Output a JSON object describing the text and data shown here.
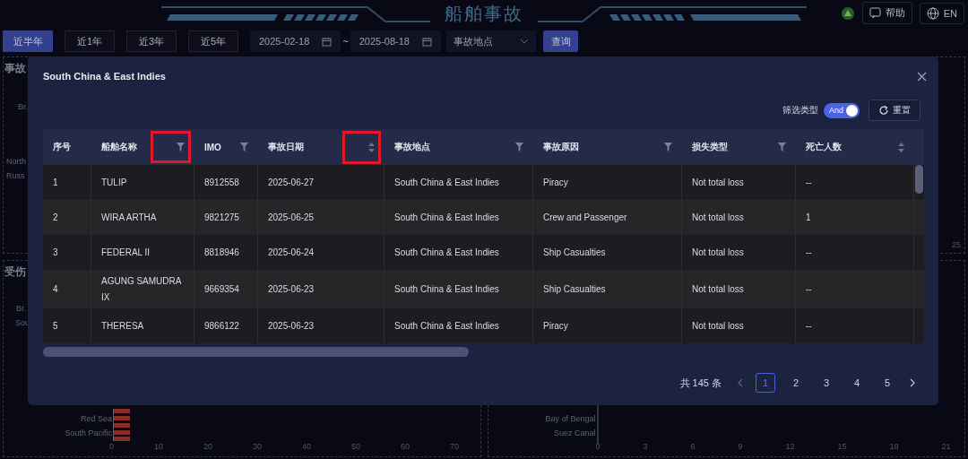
{
  "header": {
    "title": "船舶事故",
    "help": "帮助",
    "language": "EN"
  },
  "filters": {
    "ranges": [
      {
        "label": "近半年",
        "selected": true
      },
      {
        "label": "近1年",
        "selected": false
      },
      {
        "label": "近3年",
        "selected": false
      },
      {
        "label": "近5年",
        "selected": false
      }
    ],
    "start_date": "2025-02-18",
    "separator": "~",
    "end_date": "2025-08-18",
    "location": {
      "placeholder": "事故地点"
    },
    "query": "查询"
  },
  "background_panels": [
    {
      "title": "事故",
      "labels": [
        "Br.",
        "North",
        "Russ"
      ]
    },
    {
      "ticks": [
        "25"
      ]
    },
    {
      "title": "受伤",
      "labels": [
        "Br.",
        "Sou",
        "Red Sea",
        "South Pacific"
      ],
      "ticks": [
        "0",
        "10",
        "20",
        "30",
        "40",
        "50",
        "60",
        "70"
      ]
    },
    {
      "labels": [
        "Bay of Bengal",
        "Suez Canal"
      ],
      "ticks": [
        "0",
        "3",
        "6",
        "9",
        "12",
        "15",
        "18",
        "21"
      ]
    }
  ],
  "dialog": {
    "title": "South China & East Indies",
    "filter_type": {
      "label": "筛选类型",
      "toggle": {
        "label": "And",
        "on": true
      }
    },
    "reset": "重置",
    "columns": [
      {
        "label": "序号",
        "kind": "plain",
        "highlighted": false
      },
      {
        "label": "船舶名称",
        "kind": "filter",
        "highlighted": true
      },
      {
        "label": "IMO",
        "kind": "filter",
        "highlighted": false
      },
      {
        "label": "事故日期",
        "kind": "sort",
        "highlighted": true
      },
      {
        "label": "事故地点",
        "kind": "filter",
        "highlighted": false
      },
      {
        "label": "事故原因",
        "kind": "filter",
        "highlighted": false
      },
      {
        "label": "损失类型",
        "kind": "filter",
        "highlighted": false
      },
      {
        "label": "死亡人数",
        "kind": "sort",
        "highlighted": false
      }
    ],
    "rows": [
      [
        "1",
        "TULIP",
        "8912558",
        "2025-06-27",
        "South China & East Indies",
        "Piracy",
        "Not total loss",
        "--"
      ],
      [
        "2",
        "WIRA ARTHA",
        "9821275",
        "2025-06-25",
        "South China & East Indies",
        "Crew and Passenger",
        "Not total loss",
        "1"
      ],
      [
        "3",
        "FEDERAL II",
        "8818946",
        "2025-06-24",
        "South China & East Indies",
        "Ship Casualties",
        "Not total loss",
        "--"
      ],
      [
        "4",
        "AGUNG SAMUDRA IX",
        "9669354",
        "2025-06-23",
        "South China & East Indies",
        "Ship Casualties",
        "Not total loss",
        "--"
      ],
      [
        "5",
        "THERESA",
        "9866122",
        "2025-06-23",
        "South China & East Indies",
        "Piracy",
        "Not total loss",
        "--"
      ]
    ],
    "pagination": {
      "total": "共 145 条",
      "pages": [
        {
          "label": "1",
          "selected": true
        },
        {
          "label": "2",
          "selected": false
        },
        {
          "label": "3",
          "selected": false
        },
        {
          "label": "4",
          "selected": false
        },
        {
          "label": "5",
          "selected": false
        }
      ]
    }
  }
}
